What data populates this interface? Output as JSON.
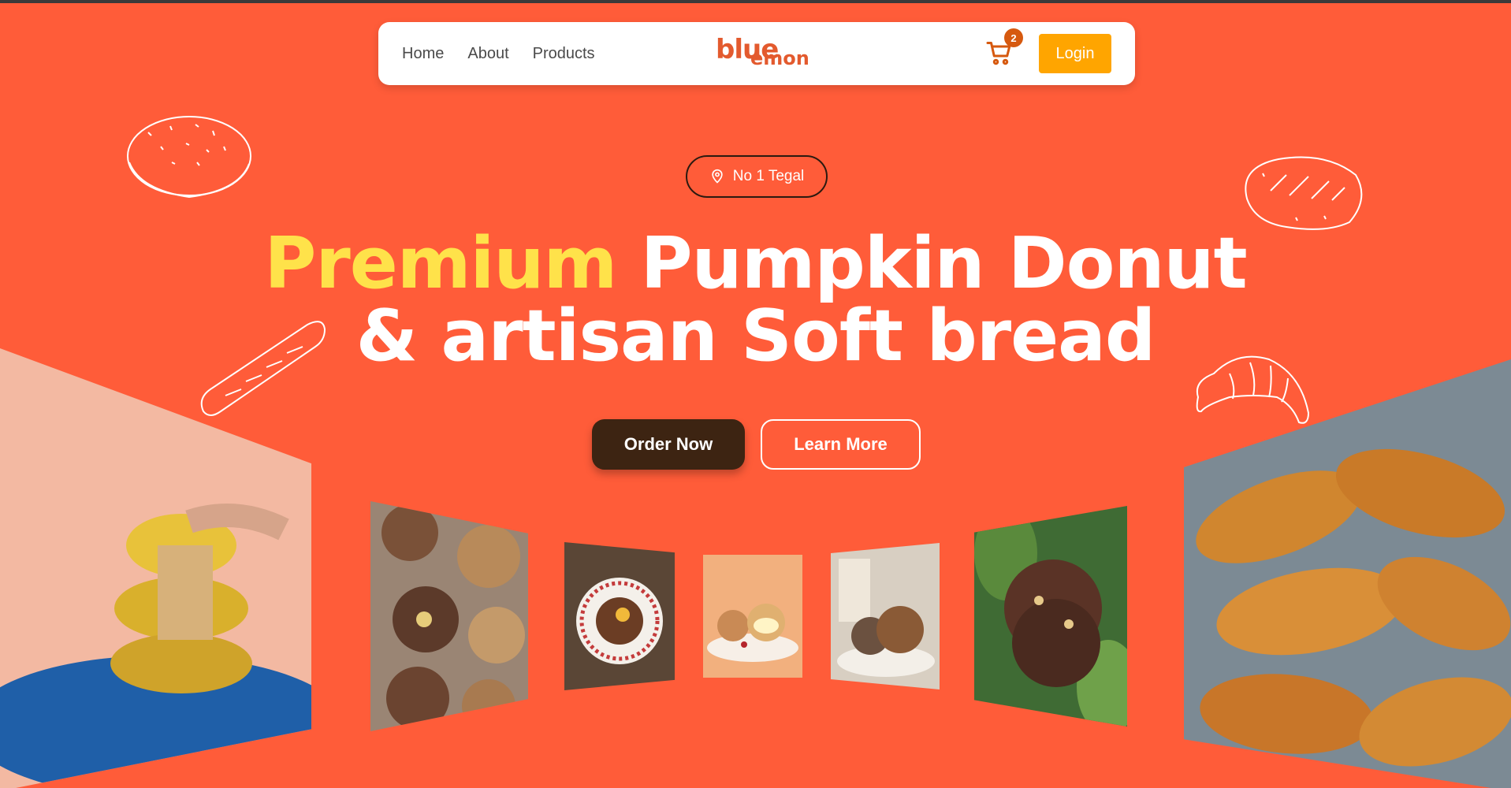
{
  "nav": {
    "links": [
      "Home",
      "About",
      "Products"
    ],
    "logo_top": "blue",
    "logo_accent": "´",
    "logo_bottom": "emon",
    "cart_count": "2",
    "login_label": "Login"
  },
  "hero": {
    "location": "No 1 Tegal",
    "headline_accent": "Premium",
    "headline_line1_rest": " Pumpkin Donut",
    "headline_line2": "& artisan Soft bread",
    "order_label": "Order Now",
    "learn_label": "Learn More"
  },
  "colors": {
    "background": "#FF5C39",
    "accent_yellow": "#FFE24A",
    "login_orange": "#FFA500",
    "order_brown": "#3d2412"
  },
  "icons": [
    "cart-icon",
    "location-pin-icon"
  ]
}
